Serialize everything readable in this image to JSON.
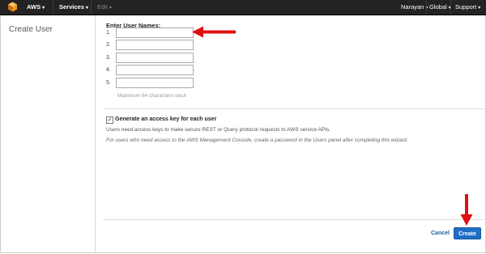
{
  "navbar": {
    "brand": "AWS",
    "services": "Services",
    "edit": "Edit",
    "user": "Narayan",
    "region": "Global",
    "support": "Support"
  },
  "sidebar": {
    "title": "Create User"
  },
  "form": {
    "heading": "Enter User Names:",
    "rows": [
      {
        "num": "1.",
        "value": ""
      },
      {
        "num": "2.",
        "value": ""
      },
      {
        "num": "3.",
        "value": ""
      },
      {
        "num": "4.",
        "value": ""
      },
      {
        "num": "5.",
        "value": ""
      }
    ],
    "hint": "Maximum 64 characters each",
    "checkbox": {
      "label": "Generate an access key for each user",
      "checked": true
    },
    "note1": "Users need access keys to make secure REST or Query protocol requests to AWS service APIs.",
    "note2": "For users who need access to the AWS Management Console, create a password in the Users panel after completing this wizard."
  },
  "footer": {
    "cancel": "Cancel",
    "create": "Create"
  },
  "colors": {
    "navbar": "#232323",
    "primary_button": "#1f6fc7",
    "annotation_arrow": "#e01010",
    "aws_logo": "#f19a1d"
  },
  "icons": [
    "aws-logo-icon",
    "chevron-down-icon",
    "checkbox-checked-icon",
    "red-arrow-left-icon",
    "red-arrow-down-icon"
  ]
}
